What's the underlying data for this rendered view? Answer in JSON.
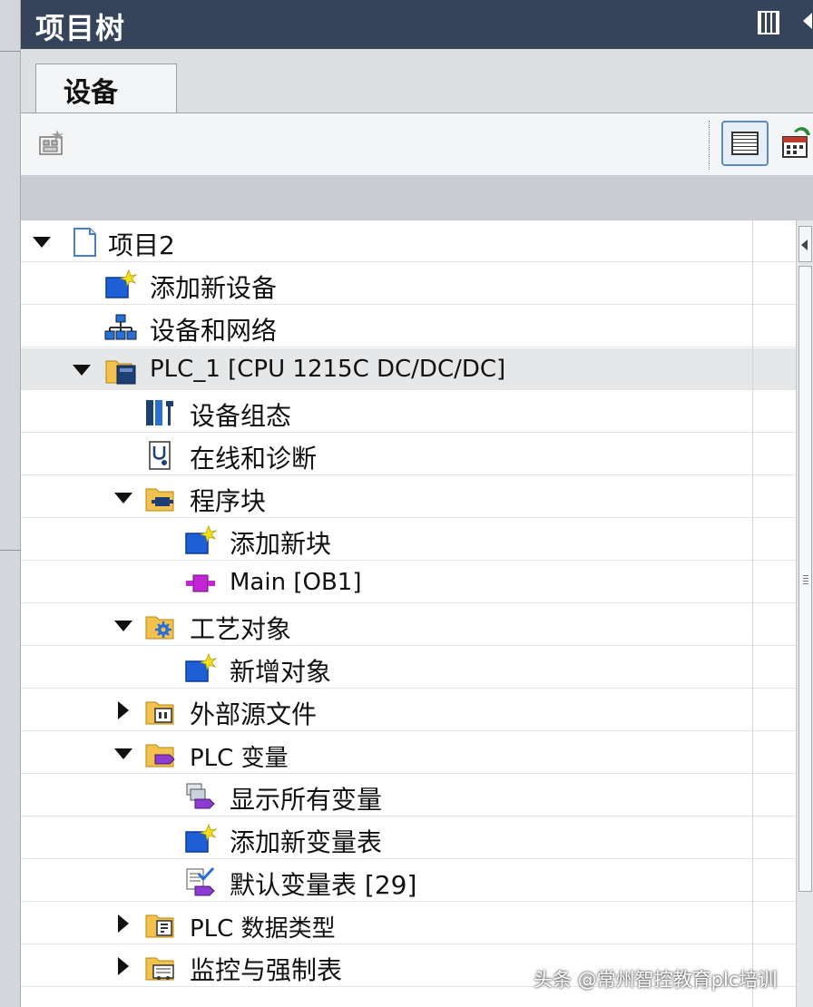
{
  "panel": {
    "title": "项目树",
    "tab_label": "设备"
  },
  "tree": {
    "items": [
      {
        "label": "项目2",
        "level": 0,
        "expander": "down",
        "icon": "project-icon"
      },
      {
        "label": "添加新设备",
        "level": 1,
        "expander": "none",
        "icon": "add-new-icon"
      },
      {
        "label": "设备和网络",
        "level": 1,
        "expander": "none",
        "icon": "network-icon"
      },
      {
        "label": "PLC_1 [CPU 1215C DC/DC/DC]",
        "level": 1,
        "expander": "down",
        "icon": "plc-folder-icon",
        "selected": true
      },
      {
        "label": "设备组态",
        "level": 2,
        "expander": "none",
        "icon": "device-config-icon"
      },
      {
        "label": "在线和诊断",
        "level": 2,
        "expander": "none",
        "icon": "diagnostics-icon"
      },
      {
        "label": "程序块",
        "level": 2,
        "expander": "down",
        "icon": "program-blocks-folder-icon"
      },
      {
        "label": "添加新块",
        "level": 3,
        "expander": "none",
        "icon": "add-new-icon"
      },
      {
        "label": "Main [OB1]",
        "level": 3,
        "expander": "none",
        "icon": "ob-block-icon"
      },
      {
        "label": "工艺对象",
        "level": 2,
        "expander": "down",
        "icon": "technology-folder-icon"
      },
      {
        "label": "新增对象",
        "level": 3,
        "expander": "none",
        "icon": "add-new-icon"
      },
      {
        "label": "外部源文件",
        "level": 2,
        "expander": "right",
        "icon": "source-files-folder-icon"
      },
      {
        "label": "PLC 变量",
        "level": 2,
        "expander": "down",
        "icon": "tags-folder-icon"
      },
      {
        "label": "显示所有变量",
        "level": 3,
        "expander": "none",
        "icon": "show-tags-icon"
      },
      {
        "label": "添加新变量表",
        "level": 3,
        "expander": "none",
        "icon": "add-new-icon"
      },
      {
        "label": "默认变量表 [29]",
        "level": 3,
        "expander": "none",
        "icon": "tag-table-icon"
      },
      {
        "label": "PLC 数据类型",
        "level": 2,
        "expander": "right",
        "icon": "datatype-folder-icon"
      },
      {
        "label": "监控与强制表",
        "level": 2,
        "expander": "right",
        "icon": "watch-folder-icon"
      }
    ]
  },
  "watermark": "头条 @常州智控教育plc培训",
  "colors": {
    "title_bar": "#35445a",
    "selected_row": "#e6e7e8",
    "folder": "#f2c14e",
    "add_blue": "#1f5fd6",
    "ob_magenta": "#c026d3"
  }
}
